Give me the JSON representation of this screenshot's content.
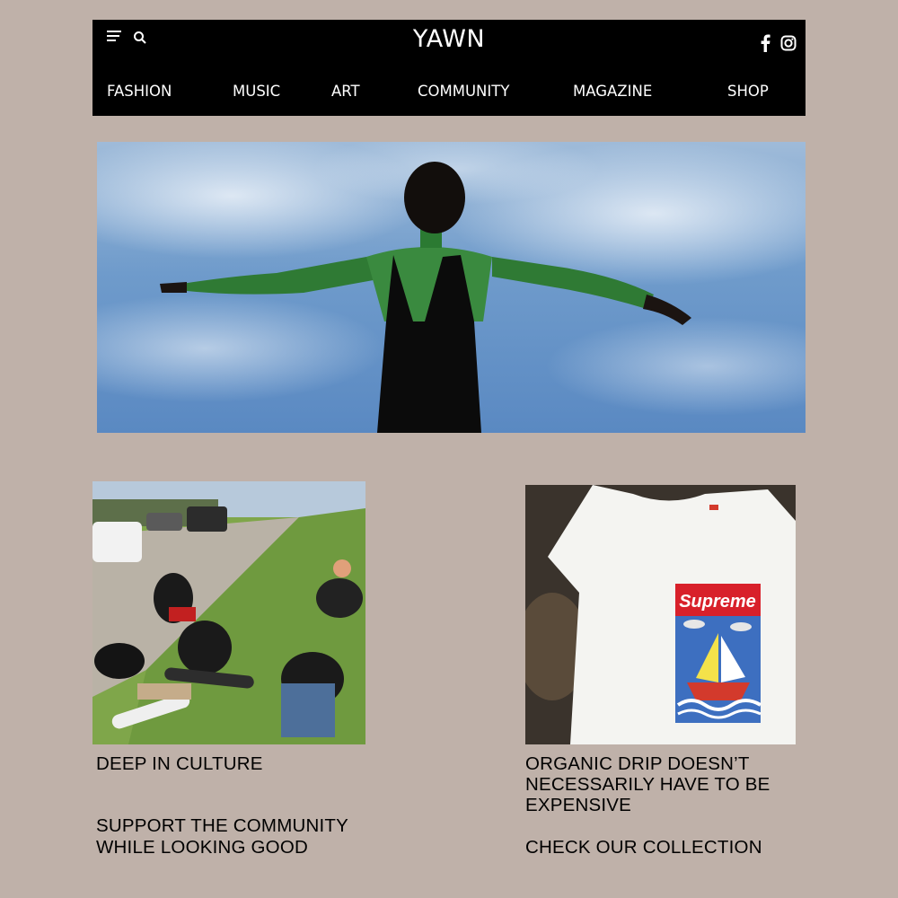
{
  "header": {
    "brand": "YAWN",
    "nav": [
      "FASHION",
      "MUSIC",
      "ART",
      "COMMUNITY",
      "MAGAZINE",
      "SHOP"
    ]
  },
  "icons": [
    "menu-icon",
    "search-icon",
    "facebook-icon",
    "instagram-icon"
  ],
  "colors": {
    "background": "#bfb1a9",
    "header": "#000000",
    "header_text": "#ffffff"
  },
  "cards": [
    {
      "title": "DEEP IN CULTURE",
      "subtitle_line1": "SUPPORT THE COMMUNITY",
      "subtitle_line2": "WHILE LOOKING GOOD"
    },
    {
      "title_line1": "ORGANIC DRIP  DOESN’T",
      "title_line2": "NECESSARILY HAVE TO BE",
      "title_line3": "EXPENSIVE",
      "cta": "CHECK OUR COLLECTION",
      "tee_brand": "Supreme"
    }
  ]
}
